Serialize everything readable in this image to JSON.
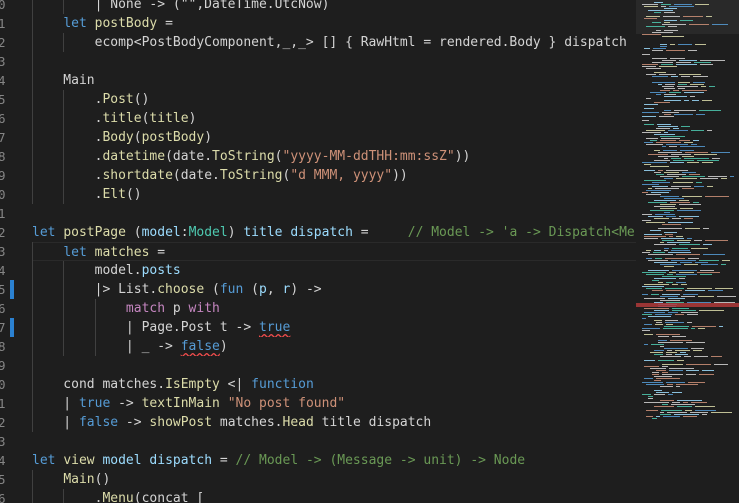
{
  "colors": {
    "background": "#1e1e1e",
    "keyword": "#569cd6",
    "control": "#c586c0",
    "function": "#dcdcaa",
    "variable": "#9cdcfe",
    "type": "#4ec9b0",
    "string": "#ce9178",
    "comment": "#6a9955",
    "text": "#d4d4d4",
    "gutter_text": "#858585",
    "modified_marker": "#2b81d1"
  },
  "gutter": {
    "line_numbers": [
      "",
      "0",
      "1",
      "2",
      "3",
      "4",
      "5",
      "6",
      "7",
      "8",
      "9",
      "0",
      "1",
      "2",
      "3",
      "4",
      "5",
      "6",
      "7",
      "8",
      "9",
      "0",
      "1",
      "2",
      "3",
      "4",
      "5",
      "6"
    ],
    "modified_lines": [
      15,
      17
    ]
  },
  "code_lines": [
    [
      {
        "t": "        | None -> (\"\",DateTime.UtcNow)",
        "c": "text"
      }
    ],
    [
      {
        "t": "    ",
        "c": "text"
      },
      {
        "t": "let",
        "c": "keyword"
      },
      {
        "t": " ",
        "c": "text"
      },
      {
        "t": "postBody",
        "c": "function"
      },
      {
        "t": " =",
        "c": "text"
      }
    ],
    [
      {
        "t": "        ecomp<PostBodyComponent,_,_> [] { RawHtml = rendered.Body } dispatch",
        "c": "text"
      }
    ],
    [
      {
        "t": "",
        "c": "text"
      }
    ],
    [
      {
        "t": "    Main",
        "c": "text"
      }
    ],
    [
      {
        "t": "        .",
        "c": "text"
      },
      {
        "t": "Post",
        "c": "function"
      },
      {
        "t": "()",
        "c": "text"
      }
    ],
    [
      {
        "t": "        .",
        "c": "text"
      },
      {
        "t": "title",
        "c": "function"
      },
      {
        "t": "(",
        "c": "text"
      },
      {
        "t": "title",
        "c": "function"
      },
      {
        "t": ")",
        "c": "text"
      }
    ],
    [
      {
        "t": "        .",
        "c": "text"
      },
      {
        "t": "Body",
        "c": "function"
      },
      {
        "t": "(",
        "c": "text"
      },
      {
        "t": "postBody",
        "c": "function"
      },
      {
        "t": ")",
        "c": "text"
      }
    ],
    [
      {
        "t": "        .",
        "c": "text"
      },
      {
        "t": "datetime",
        "c": "function"
      },
      {
        "t": "(date.",
        "c": "text"
      },
      {
        "t": "ToString",
        "c": "function"
      },
      {
        "t": "(",
        "c": "text"
      },
      {
        "t": "\"yyyy-MM-ddTHH:mm:ssZ\"",
        "c": "string"
      },
      {
        "t": "))",
        "c": "text"
      }
    ],
    [
      {
        "t": "        .",
        "c": "text"
      },
      {
        "t": "shortdate",
        "c": "function"
      },
      {
        "t": "(date.",
        "c": "text"
      },
      {
        "t": "ToString",
        "c": "function"
      },
      {
        "t": "(",
        "c": "text"
      },
      {
        "t": "\"d MMM, yyyy\"",
        "c": "string"
      },
      {
        "t": "))",
        "c": "text"
      }
    ],
    [
      {
        "t": "        .",
        "c": "text"
      },
      {
        "t": "Elt",
        "c": "function"
      },
      {
        "t": "()",
        "c": "text"
      }
    ],
    [
      {
        "t": "",
        "c": "text"
      }
    ],
    [
      {
        "t": "let",
        "c": "keyword"
      },
      {
        "t": " ",
        "c": "text"
      },
      {
        "t": "postPage",
        "c": "function"
      },
      {
        "t": " (",
        "c": "text"
      },
      {
        "t": "model",
        "c": "variable"
      },
      {
        "t": ":",
        "c": "text"
      },
      {
        "t": "Model",
        "c": "type"
      },
      {
        "t": ") ",
        "c": "text"
      },
      {
        "t": "title",
        "c": "variable"
      },
      {
        "t": " ",
        "c": "text"
      },
      {
        "t": "dispatch",
        "c": "variable"
      },
      {
        "t": " =     ",
        "c": "text"
      },
      {
        "t": "// Model -> 'a -> Dispatch<Message> -> Node",
        "c": "comment"
      }
    ],
    [
      {
        "t": "    ",
        "c": "text"
      },
      {
        "t": "let",
        "c": "keyword"
      },
      {
        "t": " ",
        "c": "text"
      },
      {
        "t": "matches",
        "c": "function"
      },
      {
        "t": " =",
        "c": "text"
      }
    ],
    [
      {
        "t": "        model.",
        "c": "text"
      },
      {
        "t": "posts",
        "c": "variable"
      }
    ],
    [
      {
        "t": "        |> List.",
        "c": "text"
      },
      {
        "t": "choose",
        "c": "function"
      },
      {
        "t": " (",
        "c": "text"
      },
      {
        "t": "fun",
        "c": "keyword"
      },
      {
        "t": " (",
        "c": "text"
      },
      {
        "t": "p",
        "c": "variable"
      },
      {
        "t": ", ",
        "c": "text"
      },
      {
        "t": "r",
        "c": "variable"
      },
      {
        "t": ") ->",
        "c": "text"
      }
    ],
    [
      {
        "t": "            ",
        "c": "text"
      },
      {
        "t": "match",
        "c": "control"
      },
      {
        "t": " p ",
        "c": "text"
      },
      {
        "t": "with",
        "c": "control"
      }
    ],
    [
      {
        "t": "            | Page.Post t -> ",
        "c": "text"
      },
      {
        "t": "true",
        "c": "keyword",
        "sq": true
      }
    ],
    [
      {
        "t": "            | _ -> ",
        "c": "text"
      },
      {
        "t": "false",
        "c": "keyword",
        "sq": true
      },
      {
        "t": ")",
        "c": "text"
      }
    ],
    [
      {
        "t": "",
        "c": "text"
      }
    ],
    [
      {
        "t": "    cond matches.",
        "c": "text"
      },
      {
        "t": "IsEmpty",
        "c": "function"
      },
      {
        "t": " <| ",
        "c": "text"
      },
      {
        "t": "function",
        "c": "keyword"
      }
    ],
    [
      {
        "t": "    | ",
        "c": "text"
      },
      {
        "t": "true",
        "c": "keyword"
      },
      {
        "t": " -> ",
        "c": "text"
      },
      {
        "t": "textInMain",
        "c": "function"
      },
      {
        "t": " ",
        "c": "text"
      },
      {
        "t": "\"No post found\"",
        "c": "string"
      }
    ],
    [
      {
        "t": "    | ",
        "c": "text"
      },
      {
        "t": "false",
        "c": "keyword"
      },
      {
        "t": " -> ",
        "c": "text"
      },
      {
        "t": "showPost",
        "c": "function"
      },
      {
        "t": " matches.",
        "c": "text"
      },
      {
        "t": "Head",
        "c": "function"
      },
      {
        "t": " title dispatch",
        "c": "text"
      }
    ],
    [
      {
        "t": "",
        "c": "text"
      }
    ],
    [
      {
        "t": "let",
        "c": "keyword"
      },
      {
        "t": " ",
        "c": "text"
      },
      {
        "t": "view",
        "c": "function"
      },
      {
        "t": " ",
        "c": "text"
      },
      {
        "t": "model",
        "c": "variable"
      },
      {
        "t": " ",
        "c": "text"
      },
      {
        "t": "dispatch",
        "c": "variable"
      },
      {
        "t": " = ",
        "c": "text"
      },
      {
        "t": "// Model -> (Message -> unit) -> Node",
        "c": "comment"
      }
    ],
    [
      {
        "t": "    ",
        "c": "text"
      },
      {
        "t": "Main",
        "c": "function"
      },
      {
        "t": "()",
        "c": "text"
      }
    ],
    [
      {
        "t": "        .",
        "c": "text"
      },
      {
        "t": "Menu",
        "c": "function"
      },
      {
        "t": "(concat [",
        "c": "text"
      }
    ]
  ],
  "current_line_index": 13
}
